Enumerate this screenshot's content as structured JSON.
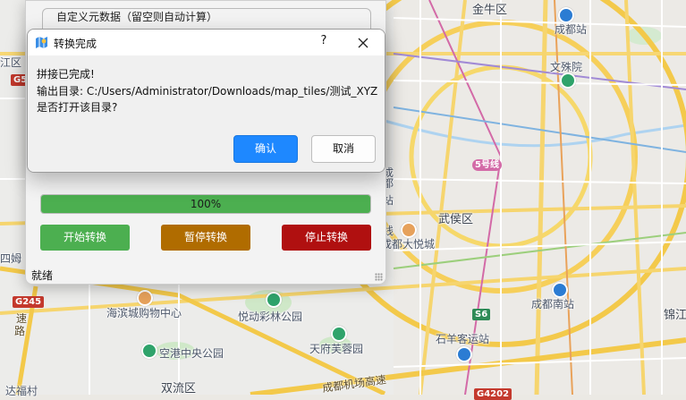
{
  "map": {
    "labels": {
      "jinniu": "金牛区",
      "chengdu_station": "成都站",
      "wenshuyuan": "文殊院",
      "wuhou": "武侯区",
      "chengdu_south": "成都南站",
      "jinjiang": "锦江",
      "haibincheng": "海滨城购物中心",
      "yuedong": "悦动彩林公园",
      "tianfu": "天府芙蓉园",
      "shiyangchang": "石羊客运站",
      "konggang": "空港中央公园",
      "shuangliu": "双流区",
      "airport_hwy": "成都机场高速",
      "chengdu_joy": "成都大悦城",
      "side_du": "都",
      "side_cheng": "成",
      "side_jiang": "江区",
      "sisi": "四姆",
      "tutu": "达福村",
      "su": "速",
      "lu": "路",
      "line5": "线",
      "zhan": "站"
    },
    "shields": {
      "g5": "G5",
      "g245": "G245",
      "s6": "S6",
      "g4202": "G4202"
    },
    "metro": "5号线"
  },
  "app": {
    "group_title": "自定义元数据（留空则自动计算）",
    "progress": {
      "percent": 100,
      "text": "100%"
    },
    "buttons": {
      "start": "开始转换",
      "pause": "暂停转换",
      "stop": "停止转换"
    },
    "status": "就绪",
    "colors": {
      "start": "#4caf50",
      "pause": "#b06c00",
      "stop": "#b01010"
    }
  },
  "dialog": {
    "title": "转换完成",
    "help": "?",
    "line1": "拼接已完成!",
    "line2": "输出目录: C:/Users/Administrator/Downloads/map_tiles/测试_XYZ",
    "line3": "是否打开该目录?",
    "ok": "确认",
    "cancel": "取消"
  }
}
